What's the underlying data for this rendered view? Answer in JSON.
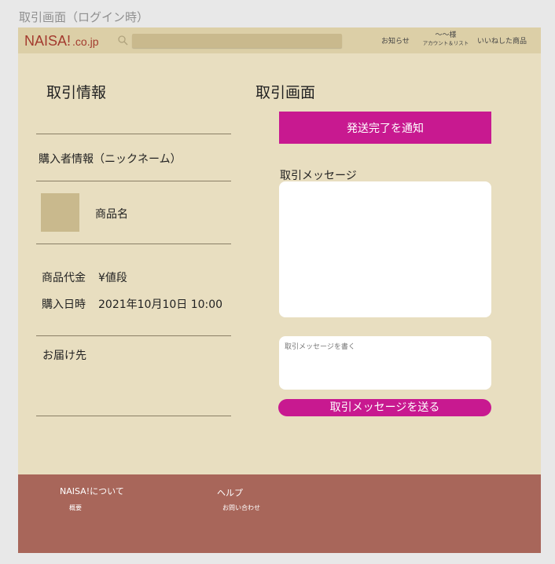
{
  "page_caption": "取引画面（ログイン時）",
  "header": {
    "logo": "NAISA!",
    "logo_domain": ".co.jp",
    "search_placeholder": "",
    "nav_news": "お知らせ",
    "nav_user": "〜〜様",
    "nav_account_sub": "アカウント＆リスト",
    "nav_likes": "いいねした商品"
  },
  "left": {
    "heading": "取引情報",
    "buyer_info": "購入者情報（ニックネーム）",
    "product_name": "商品名",
    "price_label": "商品代金",
    "price_value": "¥値段",
    "date_label": "購入日時",
    "date_value": "2021年10月10日 10:00",
    "shipping_label": "お届け先"
  },
  "right": {
    "heading": "取引画面",
    "notify_button": "発送完了を通知",
    "message_title": "取引メッセージ",
    "message_placeholder": "取引メッセージを書く",
    "send_button": "取引メッセージを送る"
  },
  "footer": {
    "about": "NAISA!について",
    "overview": "概要",
    "help": "ヘルプ",
    "contact": "お問い合わせ"
  },
  "colors": {
    "background": "#e8dec0",
    "header": "#dccfa7",
    "accent": "#c81990",
    "footer": "#a8665a",
    "logo": "#a33a2e"
  }
}
